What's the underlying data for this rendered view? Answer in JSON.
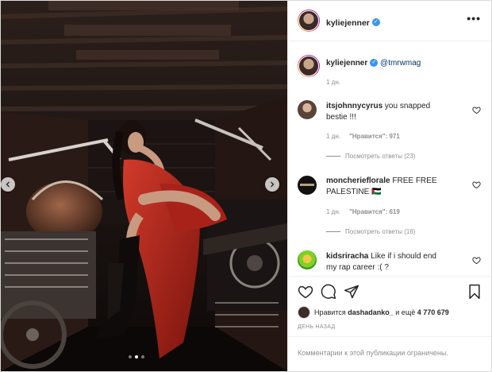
{
  "post": {
    "author": "kyliejenner",
    "caption_mention": "@tmrwmag",
    "caption_time": "1 дн."
  },
  "photo": {
    "slide_count": 3,
    "active_slide": 2
  },
  "comments": [
    {
      "username": "itsjohnnycyrus",
      "text_line1": "you snapped",
      "text_line2": "bestie !!!",
      "time": "1 дн.",
      "likes": "\"Нравится\": 971",
      "replies": "Посмотреть ответы (23)"
    },
    {
      "username": "moncherieflorale",
      "text_line1": "FREE FREE",
      "text_line2": "PALESTINE 🇵🇸",
      "time": "1 дн.",
      "likes": "\"Нравится\": 619",
      "replies": "Посмотреть ответы (16)"
    },
    {
      "username": "kidsriracha",
      "text_line1": "Like if i should end",
      "text_line2": "my rap career :( ?"
    }
  ],
  "likes": {
    "prefix": "Нравится",
    "user": "dashadanko_",
    "middle": "и ещё",
    "count": "4 770 679"
  },
  "date": "ДЕНЬ НАЗАД",
  "footer_text": "Комментарии к этой публикации ограничены.",
  "icons": {
    "more": "more-horizontal-icon",
    "like": "heart-icon",
    "comment": "comment-icon",
    "share": "send-icon",
    "save": "bookmark-icon",
    "verified": "verified-badge-icon"
  },
  "colors": {
    "verified": "#3897f0",
    "mention": "#00376b",
    "dress": "#b3261e"
  }
}
